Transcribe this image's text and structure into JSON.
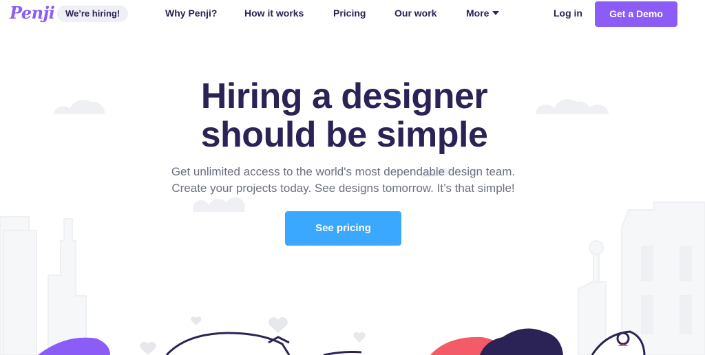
{
  "nav": {
    "logo_text": "Penji",
    "badge": "We’re hiring!",
    "links": [
      "Why Penji?",
      "How it works",
      "Pricing",
      "Our work",
      "More"
    ],
    "login": "Log in",
    "demo": "Get a Demo"
  },
  "hero": {
    "title_line1": "Hiring a designer",
    "title_line2": "should be simple",
    "sub_line1": "Get unlimited access to the world's most dependable design team.",
    "sub_line2": "Create your projects today. See designs tomorrow. It’s that simple!",
    "cta": "See pricing"
  },
  "colors": {
    "brand_purple": "#8b5cf6",
    "heading": "#2b2255",
    "cta_blue": "#3aa8ff",
    "body_text": "#6b6f7e"
  }
}
